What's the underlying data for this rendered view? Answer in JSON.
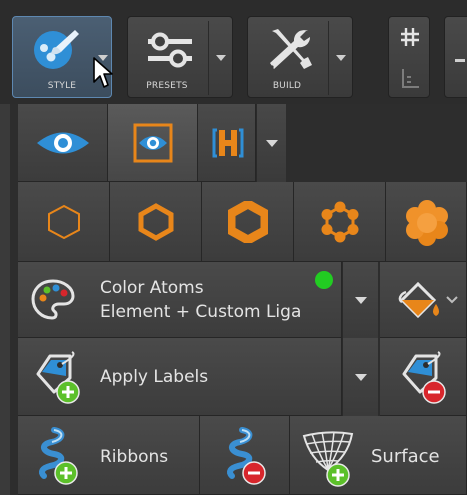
{
  "toolbar": {
    "style_label": "STYLE",
    "presets_label": "PRESETS",
    "build_label": "BUILD"
  },
  "color_atoms": {
    "title": "Color Atoms",
    "subtitle": "Element + Custom Liga"
  },
  "labels": {
    "apply": "Apply Labels"
  },
  "bottom_row": {
    "ribbons": "Ribbons",
    "surface": "Surface"
  },
  "colors": {
    "accent_orange": "#e8861a",
    "accent_blue": "#2f8fd6",
    "add_green": "#5cc02a",
    "remove_red": "#d8262c",
    "status_green": "#22cc22"
  }
}
